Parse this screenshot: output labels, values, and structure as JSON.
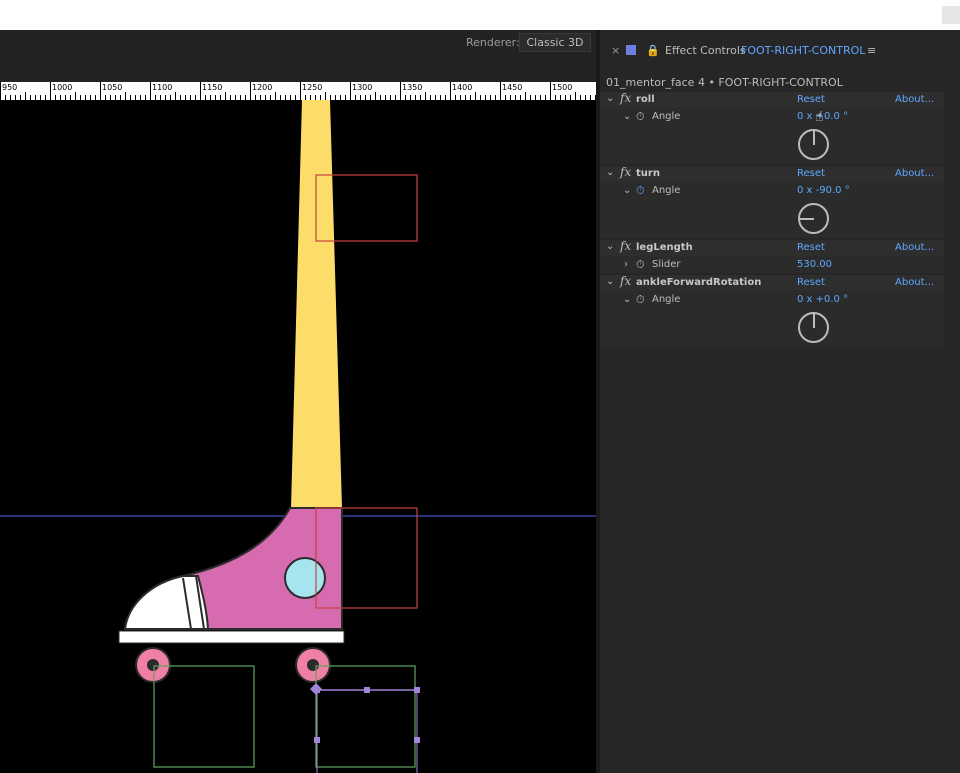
{
  "renderer": {
    "label": "Renderer:",
    "value": "Classic 3D"
  },
  "ruler": {
    "labels": [
      "950",
      "1000",
      "1050",
      "1100",
      "1150",
      "1200",
      "1250",
      "1300",
      "1350",
      "1400",
      "1450",
      "1500"
    ]
  },
  "effect_controls": {
    "panel_title": "Effect Controls",
    "layer_name": "FOOT-RIGHT-CONTROL",
    "comp_path": "01_mentor_face 4 • FOOT-RIGHT-CONTROL",
    "effects": [
      {
        "name": "roll",
        "reset": "Reset",
        "about": "About...",
        "prop": "Angle",
        "value": "0 x +0.0 °",
        "angle_deg": 0
      },
      {
        "name": "turn",
        "reset": "Reset",
        "about": "About...",
        "prop": "Angle",
        "value": "0 x -90.0 °",
        "angle_deg": -90
      },
      {
        "name": "legLength",
        "reset": "Reset",
        "about": "About...",
        "prop": "Slider",
        "value": "530.00"
      },
      {
        "name": "ankleForwardRotation",
        "reset": "Reset",
        "about": "About...",
        "prop": "Angle",
        "value": "0 x +0.0 °",
        "angle_deg": 0
      }
    ]
  },
  "colors": {
    "leg": "#fddd6a",
    "shoe": "#d66bb0",
    "wheel": "#f07fa4",
    "eyelet": "#a7e5ee",
    "guide": "#3a43a6",
    "accent": "#5ea8ff"
  }
}
